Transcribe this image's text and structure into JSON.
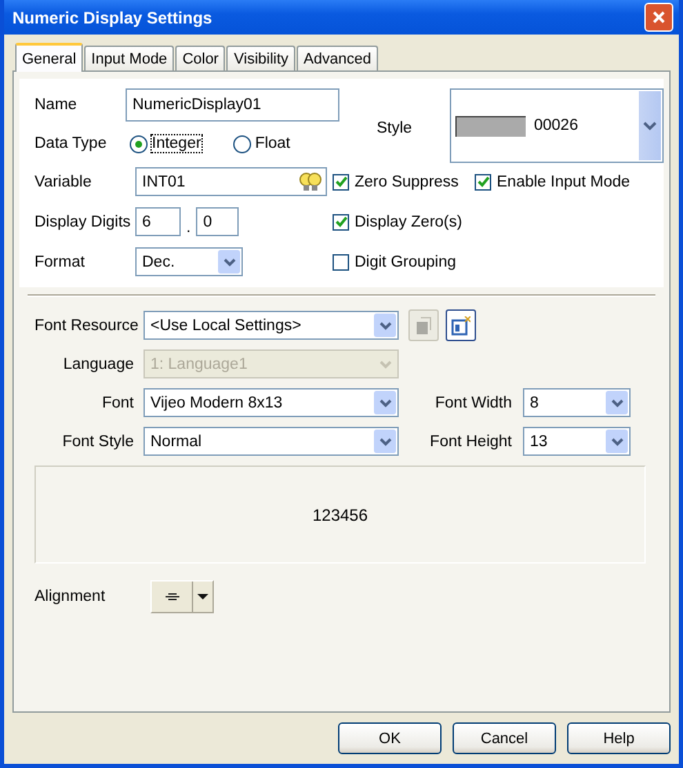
{
  "window": {
    "title": "Numeric Display Settings"
  },
  "tabs": [
    {
      "label": "General",
      "selected": true
    },
    {
      "label": "Input Mode",
      "selected": false
    },
    {
      "label": "Color",
      "selected": false
    },
    {
      "label": "Visibility",
      "selected": false
    },
    {
      "label": "Advanced",
      "selected": false
    }
  ],
  "name": {
    "label": "Name",
    "value": "NumericDisplay01"
  },
  "data_type": {
    "label": "Data Type",
    "options": [
      {
        "label": "Integer",
        "selected": true
      },
      {
        "label": "Float",
        "selected": false
      }
    ]
  },
  "style": {
    "label": "Style",
    "value": "00026"
  },
  "variable": {
    "label": "Variable",
    "value": "INT01"
  },
  "display_digits": {
    "label": "Display Digits",
    "integer": "6",
    "separator": ".",
    "fraction": "0"
  },
  "format": {
    "label": "Format",
    "value": "Dec."
  },
  "checkboxes": [
    {
      "label": "Zero Suppress",
      "checked": true
    },
    {
      "label": "Enable Input Mode",
      "checked": true
    },
    {
      "label": "Display Zero(s)",
      "checked": true
    },
    {
      "label": "Digit Grouping",
      "checked": false
    }
  ],
  "font_resource": {
    "label": "Font Resource",
    "value": "<Use Local Settings>"
  },
  "language": {
    "label": "Language",
    "value": "1: Language1",
    "disabled": true
  },
  "font": {
    "label": "Font",
    "value": "Vijeo Modern 8x13"
  },
  "font_width": {
    "label": "Font Width",
    "value": "8"
  },
  "font_style": {
    "label": "Font Style",
    "value": "Normal"
  },
  "font_height": {
    "label": "Font Height",
    "value": "13"
  },
  "preview": "123456",
  "alignment": {
    "label": "Alignment"
  },
  "buttons": [
    "OK",
    "Cancel",
    "Help"
  ]
}
